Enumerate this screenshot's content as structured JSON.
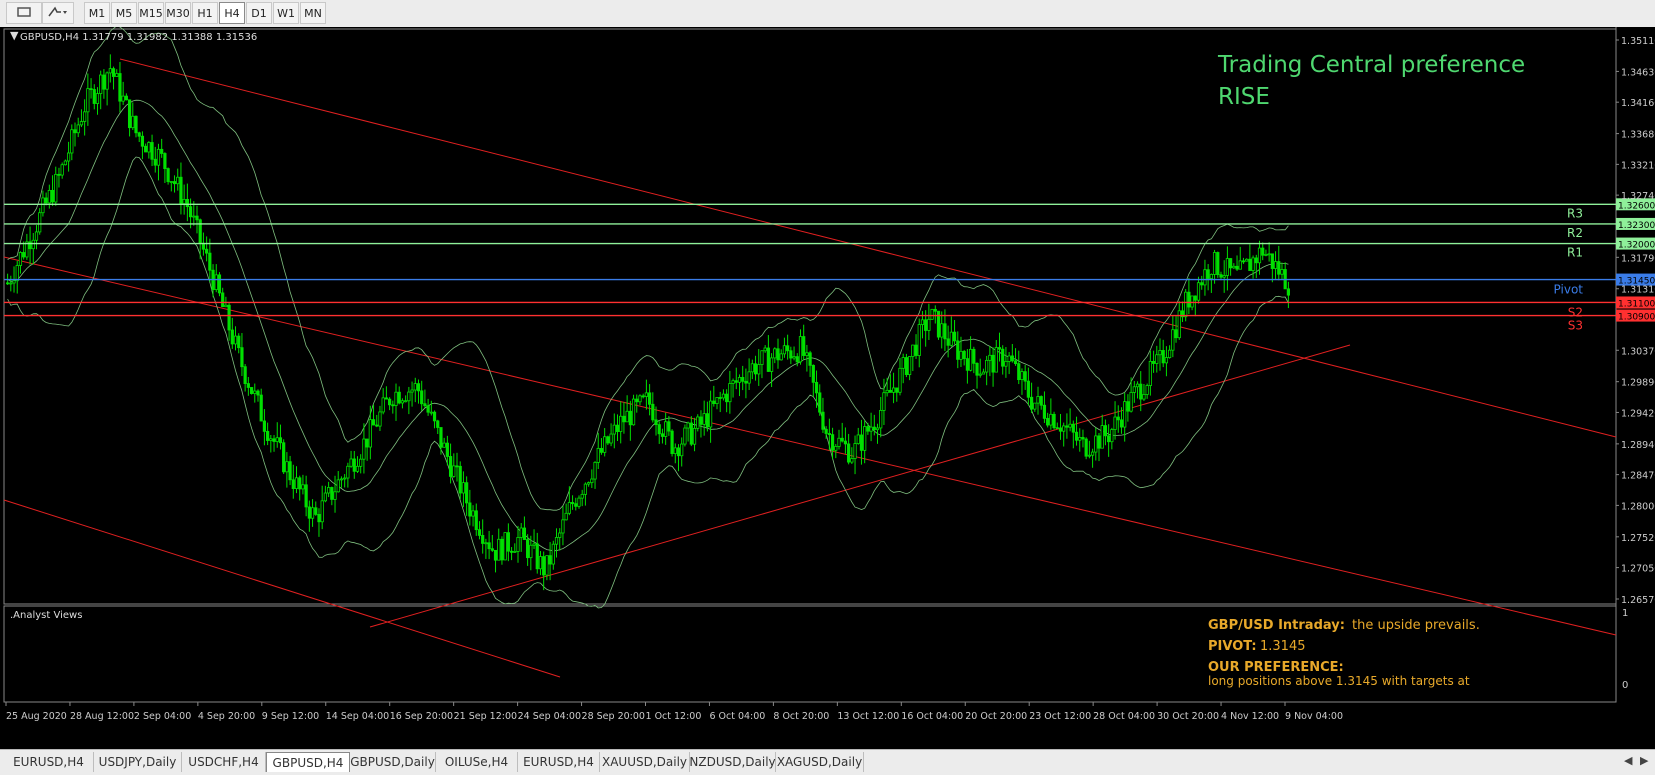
{
  "toolbar": {
    "timeframes": [
      "M1",
      "M5",
      "M15",
      "M30",
      "H1",
      "H4",
      "D1",
      "W1",
      "MN"
    ],
    "active_timeframe": "H4"
  },
  "chart": {
    "header": "GBPUSD,H4  1.31779 1.31982 1.31388 1.31536",
    "overlay_title": "Trading Central preference",
    "overlay_direction": "RISE",
    "level_labels": {
      "r3": "R3",
      "r2": "R2",
      "r1": "R1",
      "pivot": "Pivot",
      "s2": "S2",
      "s3": "S3"
    },
    "level_tags": {
      "r3": "1.32600",
      "r2": "1.32300",
      "r1": "1.32000",
      "pivot": "1.31450",
      "s2": "1.31100",
      "s3": "1.30900"
    },
    "y_ticks": [
      "1.35110",
      "1.34630",
      "1.34160",
      "1.33680",
      "1.33210",
      "1.32740",
      "1.31790",
      "1.31310",
      "1.30370",
      "1.29890",
      "1.29420",
      "1.28940",
      "1.28470",
      "1.28000",
      "1.27520",
      "1.27050",
      "1.26570"
    ],
    "x_ticks": [
      "25 Aug 2020",
      "28 Aug 12:00",
      "2 Sep 04:00",
      "4 Sep 20:00",
      "9 Sep 12:00",
      "14 Sep 04:00",
      "16 Sep 20:00",
      "21 Sep 12:00",
      "24 Sep 04:00",
      "28 Sep 20:00",
      "1 Oct 12:00",
      "6 Oct 04:00",
      "8 Oct 20:00",
      "13 Oct 12:00",
      "16 Oct 04:00",
      "20 Oct 20:00",
      "23 Oct 12:00",
      "28 Oct 04:00",
      "30 Oct 20:00",
      "4 Nov 12:00",
      "9 Nov 04:00"
    ],
    "colors": {
      "bull": "#00e000",
      "bands": "#7fbf7f",
      "resistance": "#8ff09a",
      "support": "#ff3030",
      "pivot": "#3a7ce8",
      "trend": "#e02020"
    }
  },
  "analyst": {
    "panel_label": ".Analyst Views",
    "scale_top": "1",
    "scale_bottom": "0",
    "headline_label": "GBP/USD Intraday:",
    "headline_value": "the upside prevails.",
    "pivot_label": "PIVOT:",
    "pivot_value": "1.3145",
    "preference_label": "OUR PREFERENCE:",
    "preference_text": "long positions above 1.3145 with targets at"
  },
  "tabs": [
    "EURUSD,H4",
    "USDJPY,Daily",
    "USDCHF,H4",
    "GBPUSD,H4",
    "GBPUSD,Daily",
    "OILUSe,H4",
    "EURUSD,H4",
    "XAUUSD,Daily",
    "NZDUSD,Daily",
    "XAGUSD,Daily"
  ],
  "active_tab": "GBPUSD,H4",
  "chart_data": {
    "type": "candlestick",
    "symbol": "GBPUSD",
    "timeframe": "H4",
    "ohlc_last": {
      "open": 1.31779,
      "high": 1.31982,
      "low": 1.31388,
      "close": 1.31536
    },
    "ylim": [
      1.2657,
      1.3511
    ],
    "levels": [
      {
        "name": "R3",
        "value": 1.326
      },
      {
        "name": "R2",
        "value": 1.323
      },
      {
        "name": "R1",
        "value": 1.32
      },
      {
        "name": "Pivot",
        "value": 1.3145
      },
      {
        "name": "S2",
        "value": 1.311
      },
      {
        "name": "S3",
        "value": 1.309
      }
    ],
    "close_path": [
      1.314,
      1.322,
      1.33,
      1.341,
      1.347,
      1.337,
      1.333,
      1.326,
      1.315,
      1.303,
      1.293,
      1.285,
      1.278,
      1.284,
      1.29,
      1.297,
      1.298,
      1.289,
      1.28,
      1.273,
      1.275,
      1.27,
      1.28,
      1.287,
      1.293,
      1.296,
      1.289,
      1.292,
      1.297,
      1.301,
      1.303,
      1.304,
      1.291,
      1.288,
      1.294,
      1.301,
      1.309,
      1.304,
      1.301,
      1.303,
      1.296,
      1.293,
      1.289,
      1.291,
      1.297,
      1.302,
      1.311,
      1.317,
      1.315,
      1.319,
      1.314
    ]
  }
}
